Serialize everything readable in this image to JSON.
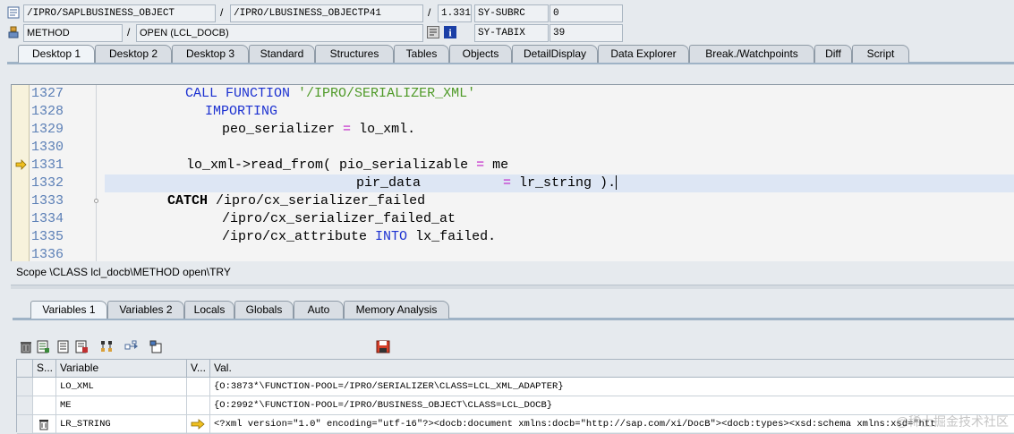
{
  "header": {
    "program": "/IPRO/SAPLBUSINESS_OBJECT",
    "include": "/IPRO/LBUSINESS_OBJECTP41",
    "line_value": "1.331",
    "sy_subrc_label": "SY-SUBRC",
    "sy_subrc_value": "0",
    "event_type": "METHOD",
    "event_name": "OPEN (LCL_DOCB)",
    "sy_tabix_label": "SY-TABIX",
    "sy_tabix_value": "39",
    "separator": "/"
  },
  "desktop_tabs": [
    {
      "label": "Desktop 1",
      "active": true
    },
    {
      "label": "Desktop 2",
      "active": false
    },
    {
      "label": "Desktop 3",
      "active": false
    },
    {
      "label": "Standard",
      "active": false
    },
    {
      "label": "Structures",
      "active": false
    },
    {
      "label": "Tables",
      "active": false
    },
    {
      "label": "Objects",
      "active": false
    },
    {
      "label": "DetailDisplay",
      "active": false
    },
    {
      "label": "Data Explorer",
      "active": false
    },
    {
      "label": "Break./Watchpoints",
      "active": false
    },
    {
      "label": "Diff",
      "active": false
    },
    {
      "label": "Script",
      "active": false
    }
  ],
  "code": {
    "line_numbers": [
      "1327",
      "1328",
      "1329",
      "1330",
      "1331",
      "1332",
      "1333",
      "1334",
      "1335",
      "1336"
    ],
    "current_line": "1331",
    "lines": {
      "l1327_a": "CALL FUNCTION",
      "l1327_b": "'/IPRO/SERIALIZER_XML'",
      "l1328": "IMPORTING",
      "l1329_a": "peo_serializer",
      "l1329_op": "=",
      "l1329_b": "lo_xml.",
      "l1331_a": "lo_xml->read_from(",
      "l1331_b": "pio_serializable",
      "l1331_op": "=",
      "l1331_c": "me",
      "l1332_a": "pir_data",
      "l1332_op": "=",
      "l1332_b": "lr_string ).",
      "l1333_a": "CATCH",
      "l1333_b": "/ipro/cx_serializer_failed",
      "l1334": "/ipro/cx_serializer_failed_at",
      "l1335_a": "/ipro/cx_attribute",
      "l1335_kw": "INTO",
      "l1335_b": "lx_failed."
    }
  },
  "scope": "Scope \\CLASS lcl_docb\\METHOD open\\TRY",
  "variable_tabs": [
    {
      "label": "Variables 1",
      "active": true
    },
    {
      "label": "Variables 2",
      "active": false
    },
    {
      "label": "Locals",
      "active": false
    },
    {
      "label": "Globals",
      "active": false
    },
    {
      "label": "Auto",
      "active": false
    },
    {
      "label": "Memory Analysis",
      "active": false
    }
  ],
  "table": {
    "columns": {
      "s": "S...",
      "variable": "Variable",
      "v": "V...",
      "val": "Val."
    },
    "rows": [
      {
        "variable": "LO_XML",
        "value": "{O:3873*\\FUNCTION-POOL=/IPRO/SERIALIZER\\CLASS=LCL_XML_ADAPTER}"
      },
      {
        "variable": "ME",
        "value": "{O:2992*\\FUNCTION-POOL=/IPRO/BUSINESS_OBJECT\\CLASS=LCL_DOCB}"
      },
      {
        "variable": "LR_STRING",
        "value": "<?xml version=\"1.0\" encoding=\"utf-16\"?><docb:document xmlns:docb=\"http://sap.com/xi/DocB\"><docb:types><xsd:schema xmlns:xsd=\"htt"
      }
    ]
  },
  "watermark": "@稀土掘金技术社区",
  "colors": {
    "keyword": "#1d32d1",
    "string": "#4f9a28",
    "operator": "#c01fc7",
    "line_number": "#5b7fb6",
    "background": "#e6eaee"
  },
  "icons": [
    "document-icon",
    "method-icon",
    "navigate-icon",
    "info-icon",
    "delete-icon",
    "detail-icon",
    "list-icon",
    "save-variant-icon",
    "hierarchy-icon",
    "move-icon",
    "new-icon",
    "save-icon",
    "arrow-right-icon",
    "trash-icon"
  ]
}
